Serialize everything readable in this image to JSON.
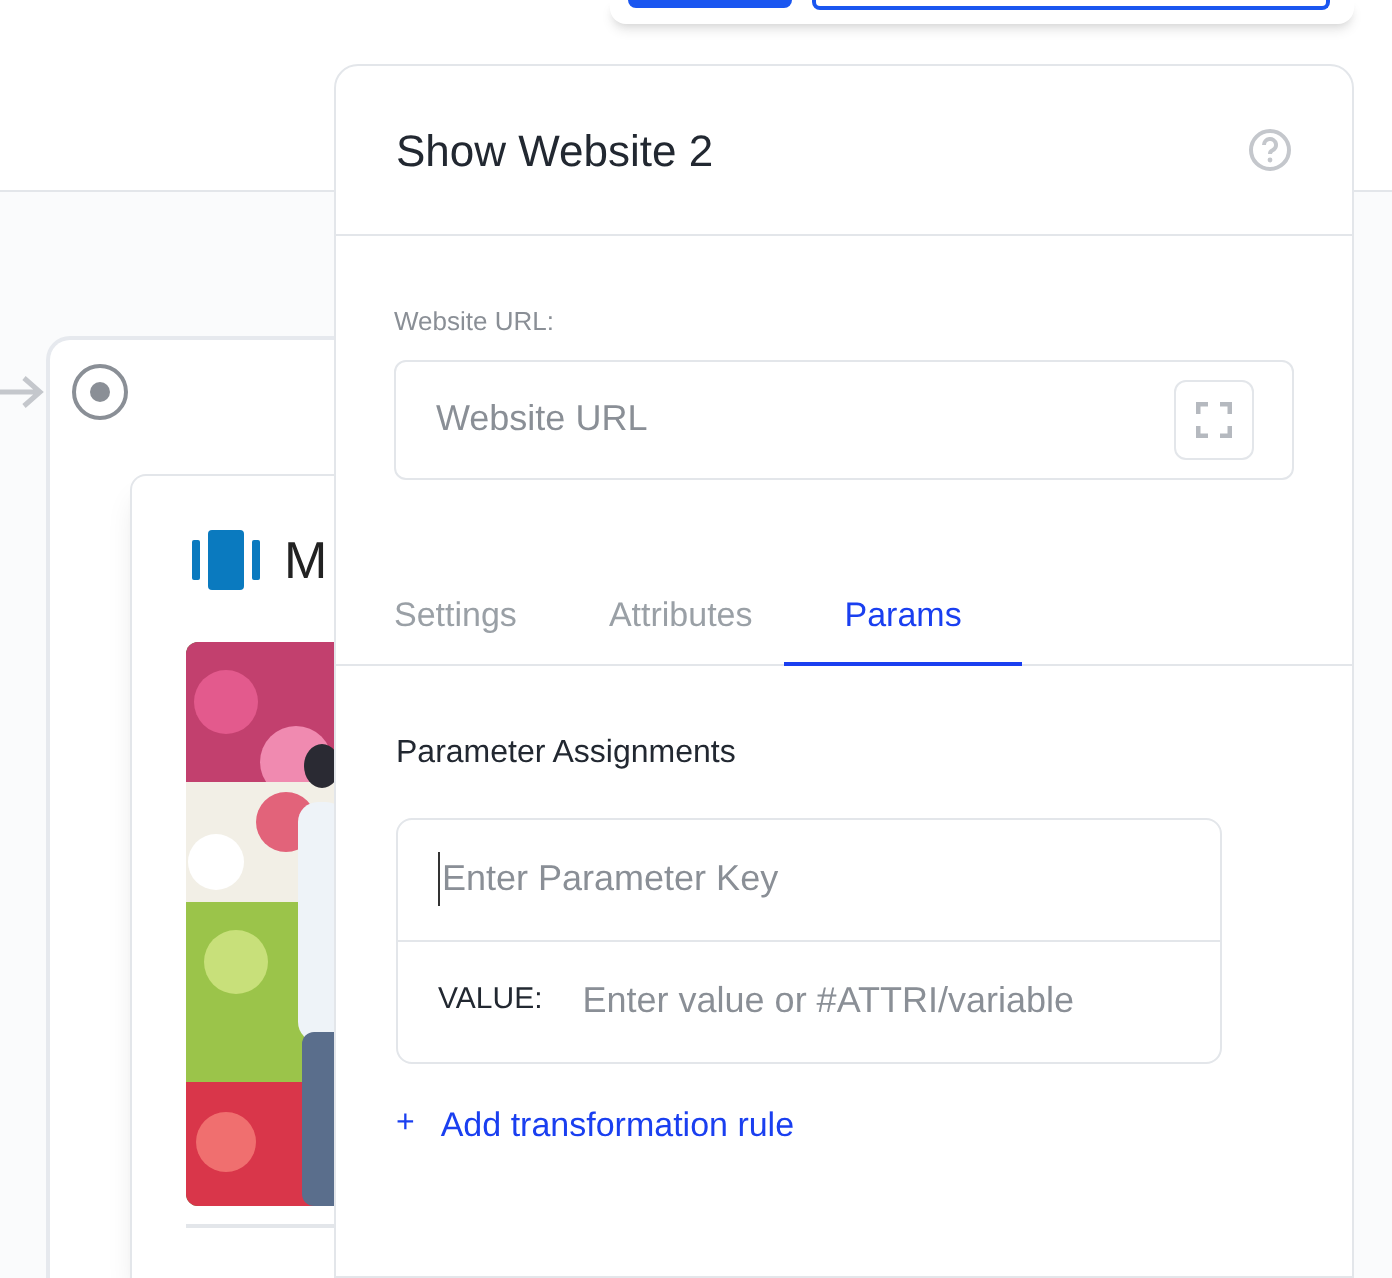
{
  "canvas": {
    "node": {
      "title": "M"
    }
  },
  "panel": {
    "title": "Show Website 2",
    "url_field": {
      "label": "Website URL:",
      "placeholder": "Website URL"
    },
    "tabs": [
      {
        "label": "Settings",
        "selected": false
      },
      {
        "label": "Attributes",
        "selected": false
      },
      {
        "label": "Params",
        "selected": true
      }
    ],
    "section_title": "Parameter Assignments",
    "parameter": {
      "key_placeholder": "Enter Parameter Key",
      "value_label": "VALUE:",
      "value_placeholder": "Enter value or #ATTRI/variable"
    },
    "add_rule": {
      "icon": "+",
      "label": "Add transformation rule"
    }
  }
}
